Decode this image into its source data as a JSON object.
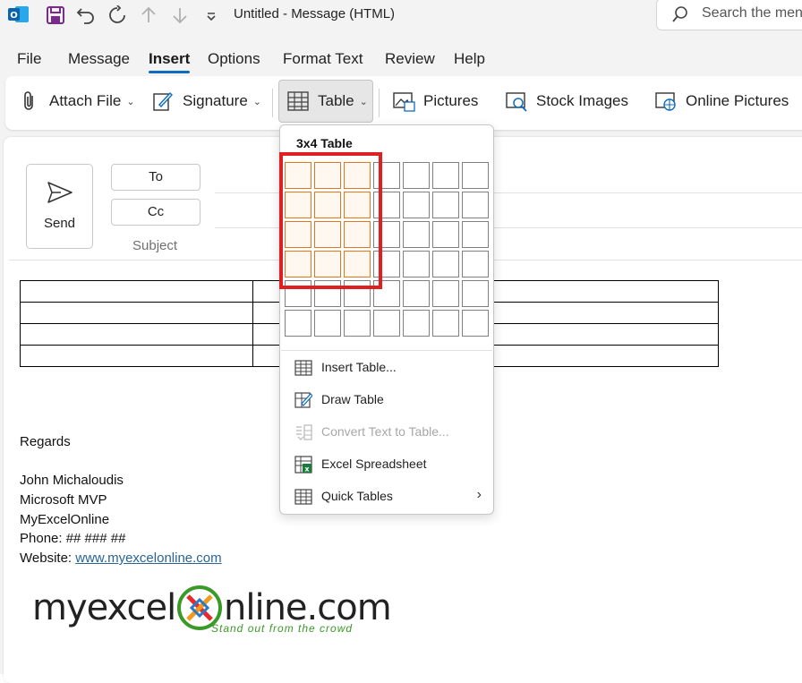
{
  "window": {
    "title": "Untitled  -  Message (HTML)"
  },
  "search": {
    "placeholder": "Search the menus"
  },
  "quick_access": [
    "save-icon",
    "undo-icon",
    "redo-icon",
    "up-arrow-icon",
    "down-arrow-icon",
    "customize-dropdown-icon"
  ],
  "menu": {
    "tabs": [
      {
        "label": "File"
      },
      {
        "label": "Message"
      },
      {
        "label": "Insert",
        "active": true
      },
      {
        "label": "Options"
      },
      {
        "label": "Format Text"
      },
      {
        "label": "Review"
      },
      {
        "label": "Help"
      }
    ]
  },
  "ribbon": {
    "attach_file": "Attach File",
    "signature": "Signature",
    "table": "Table",
    "pictures": "Pictures",
    "stock_images": "Stock Images",
    "online_pictures": "Online Pictures"
  },
  "compose": {
    "send": "Send",
    "to": "To",
    "cc": "Cc",
    "subject": "Subject"
  },
  "signature": {
    "regards": "Regards",
    "name": "John Michaloudis",
    "title": "Microsoft MVP",
    "company": "MyExcelOnline",
    "phone": "Phone: ## ### ##",
    "website_label": "Website: ",
    "website_link": "www.myexcelonline.com",
    "logo_text_left": "myexcel",
    "logo_text_right": "nline.com",
    "logo_tagline": "Stand out from the crowd"
  },
  "table_dropdown": {
    "title": "3x4 Table",
    "grid_columns": 7,
    "grid_rows": 6,
    "selected_columns": 3,
    "selected_rows": 4,
    "items": [
      {
        "label": "Insert Table...",
        "icon": "insert-table-icon",
        "enabled": true
      },
      {
        "label": "Draw Table",
        "icon": "draw-table-icon",
        "enabled": true
      },
      {
        "label": "Convert Text to Table...",
        "icon": "convert-text-icon",
        "enabled": false
      },
      {
        "label": "Excel Spreadsheet",
        "icon": "excel-icon",
        "enabled": true
      },
      {
        "label": "Quick Tables",
        "icon": "quick-tables-icon",
        "enabled": true,
        "submenu": true
      }
    ]
  },
  "colors": {
    "accent": "#0f6cbd",
    "selection_border": "#e2771f",
    "highlight_box": "#e02020",
    "logo_green": "#3a9a28"
  }
}
